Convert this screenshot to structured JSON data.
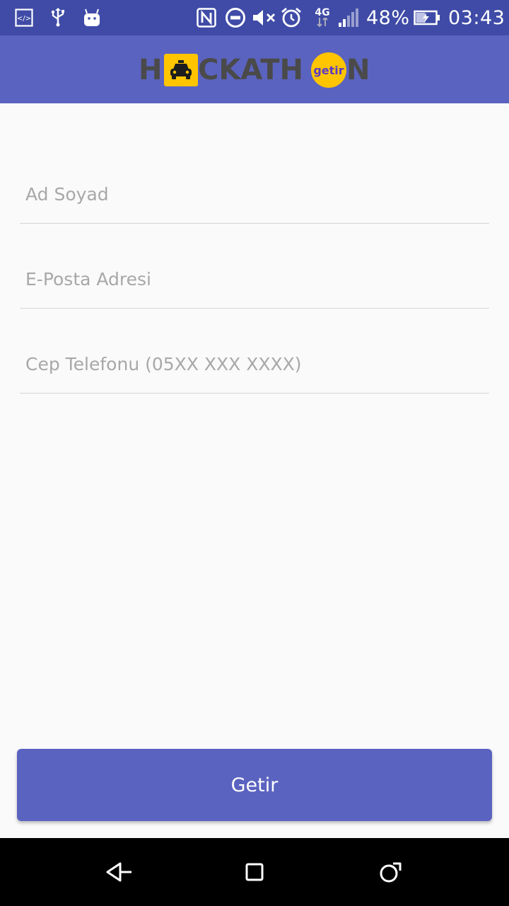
{
  "status_bar": {
    "icons": [
      "developer-mode-icon",
      "usb-icon",
      "android-icon",
      "nfc-icon",
      "do-not-disturb-icon",
      "volume-muted-icon",
      "alarm-icon",
      "network-4g-icon",
      "signal-icon",
      "battery-charging-icon"
    ],
    "network_label": "4G",
    "battery_percent": "48%",
    "battery_level": 0.48,
    "time": "03:43",
    "bg_color": "#3f4ba6"
  },
  "app_bar": {
    "logo": {
      "text": "HACKATHON",
      "letters_left": "H",
      "letters_middle": "CKATH",
      "letters_right": "N",
      "badge_text": "getir",
      "badge_icon": "taxi-icon",
      "badge_color": "#ffc500"
    },
    "bg_color": "#5b63c0"
  },
  "form": {
    "fields": [
      {
        "placeholder": "Ad Soyad",
        "value": ""
      },
      {
        "placeholder": "E-Posta Adresi",
        "value": ""
      },
      {
        "placeholder": "Cep Telefonu (05XX XXX XXXX)",
        "value": ""
      }
    ]
  },
  "submit_button": {
    "label": "Getir",
    "color": "#5b63c0"
  },
  "nav_bar": {
    "icons": [
      "back-icon",
      "home-icon",
      "recents-icon"
    ]
  }
}
